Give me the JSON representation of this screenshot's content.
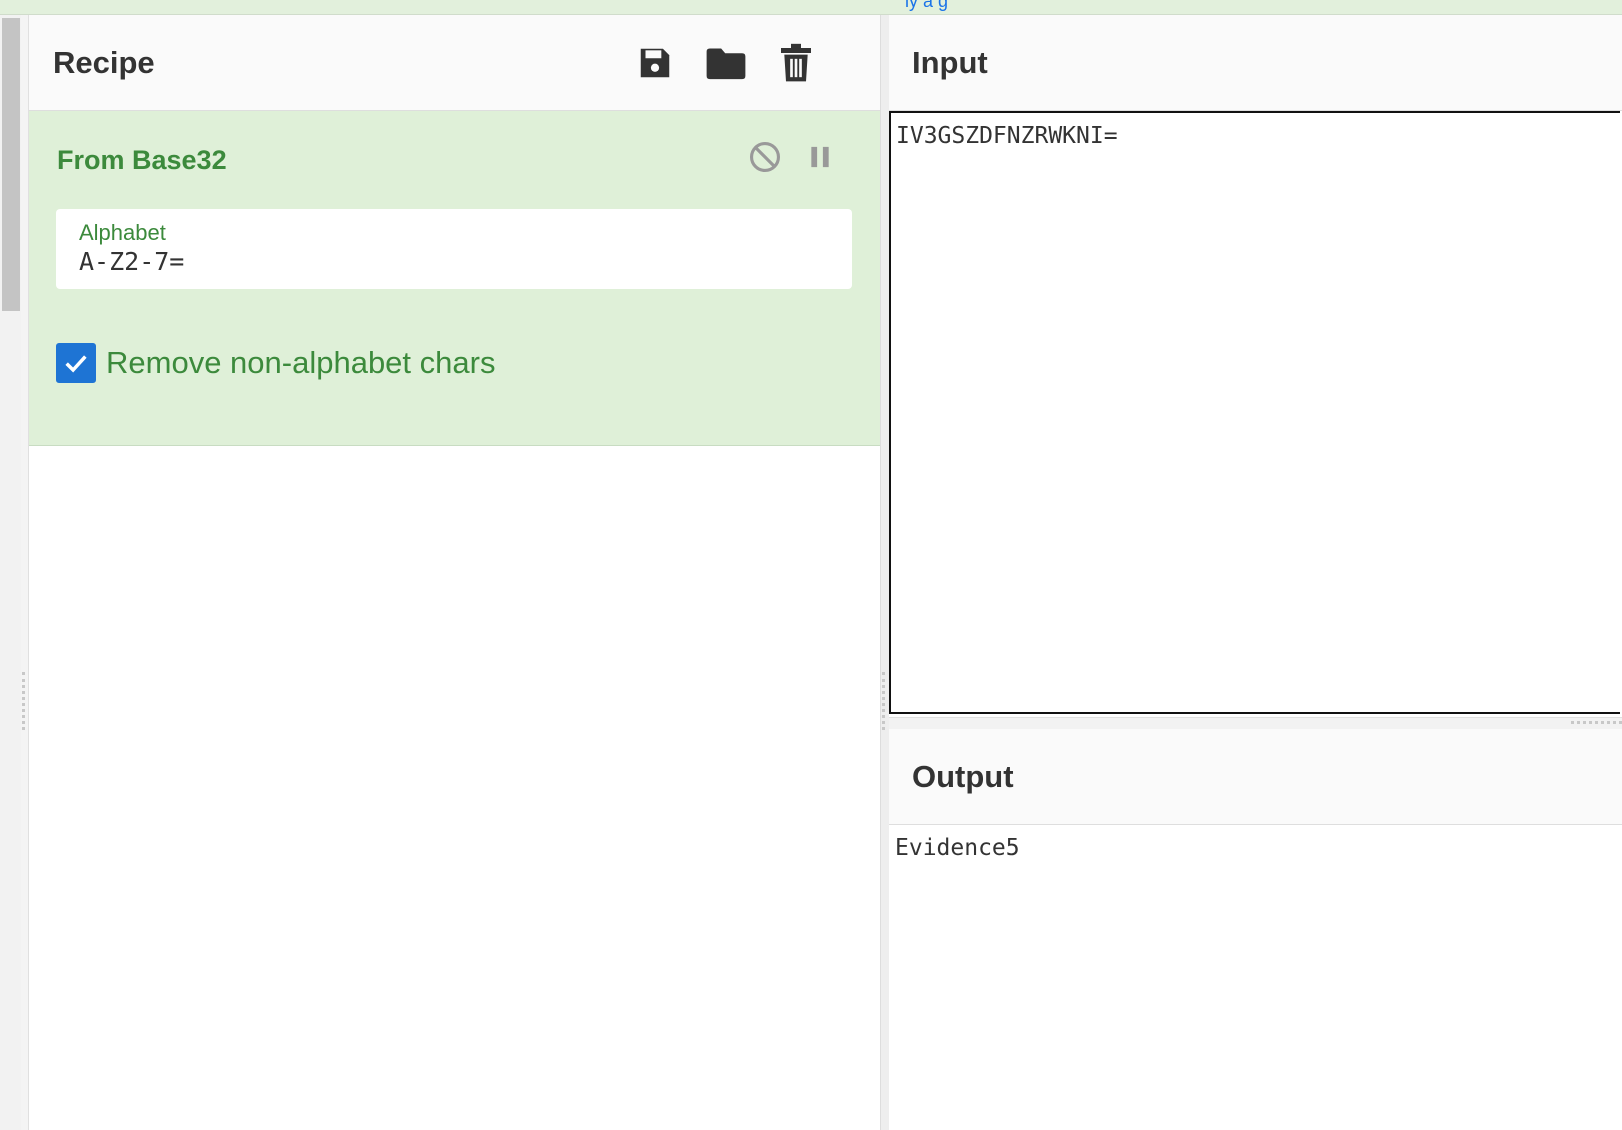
{
  "top_bar": {
    "link_fragment": "ly a g"
  },
  "recipe": {
    "title": "Recipe",
    "header_icons": [
      "save-icon",
      "folder-icon",
      "trash-icon"
    ],
    "operation": {
      "name": "From Base32",
      "icons": [
        "disable-icon",
        "pause-icon"
      ],
      "alphabet": {
        "label": "Alphabet",
        "value": "A-Z2-7="
      },
      "remove_non_alphabet": {
        "label": "Remove non-alphabet chars",
        "checked": true
      }
    }
  },
  "input": {
    "title": "Input",
    "value": "IV3GSZDFNZRWKNI="
  },
  "output": {
    "title": "Output",
    "value": "Evidence5"
  },
  "colors": {
    "accent_green": "#3c8a3c",
    "operation_bg": "#dff0d8",
    "checkbox_blue": "#1e74d4"
  }
}
